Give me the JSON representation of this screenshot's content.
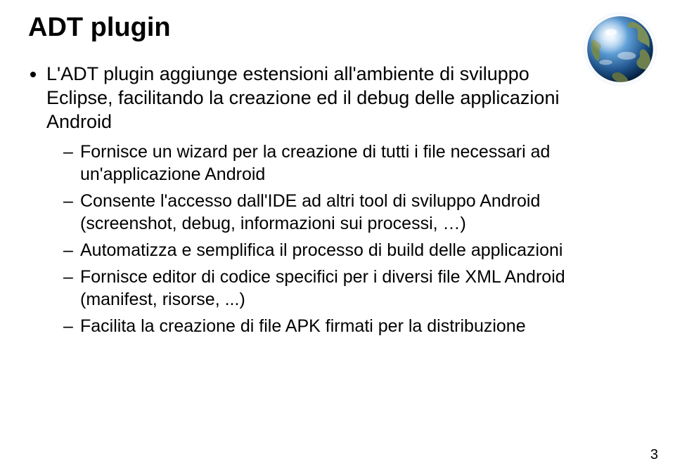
{
  "title": "ADT plugin",
  "bullets": {
    "main": "L'ADT plugin aggiunge estensioni all'ambiente di sviluppo Eclipse, facilitando la creazione ed il debug delle applicazioni Android",
    "subs": [
      "Fornisce un wizard per la creazione di tutti i file necessari ad un'applicazione Android",
      "Consente l'accesso dall'IDE ad altri tool di sviluppo Android (screenshot, debug, informazioni sui processi, …)",
      "Automatizza e semplifica il processo di build delle applicazioni",
      "Fornisce editor di codice specifici per i diversi file XML Android (manifest, risorse, ...)",
      "Facilita la creazione di file APK firmati per la distribuzione"
    ]
  },
  "page_number": "3",
  "globe_alt": "earth-globe-icon"
}
